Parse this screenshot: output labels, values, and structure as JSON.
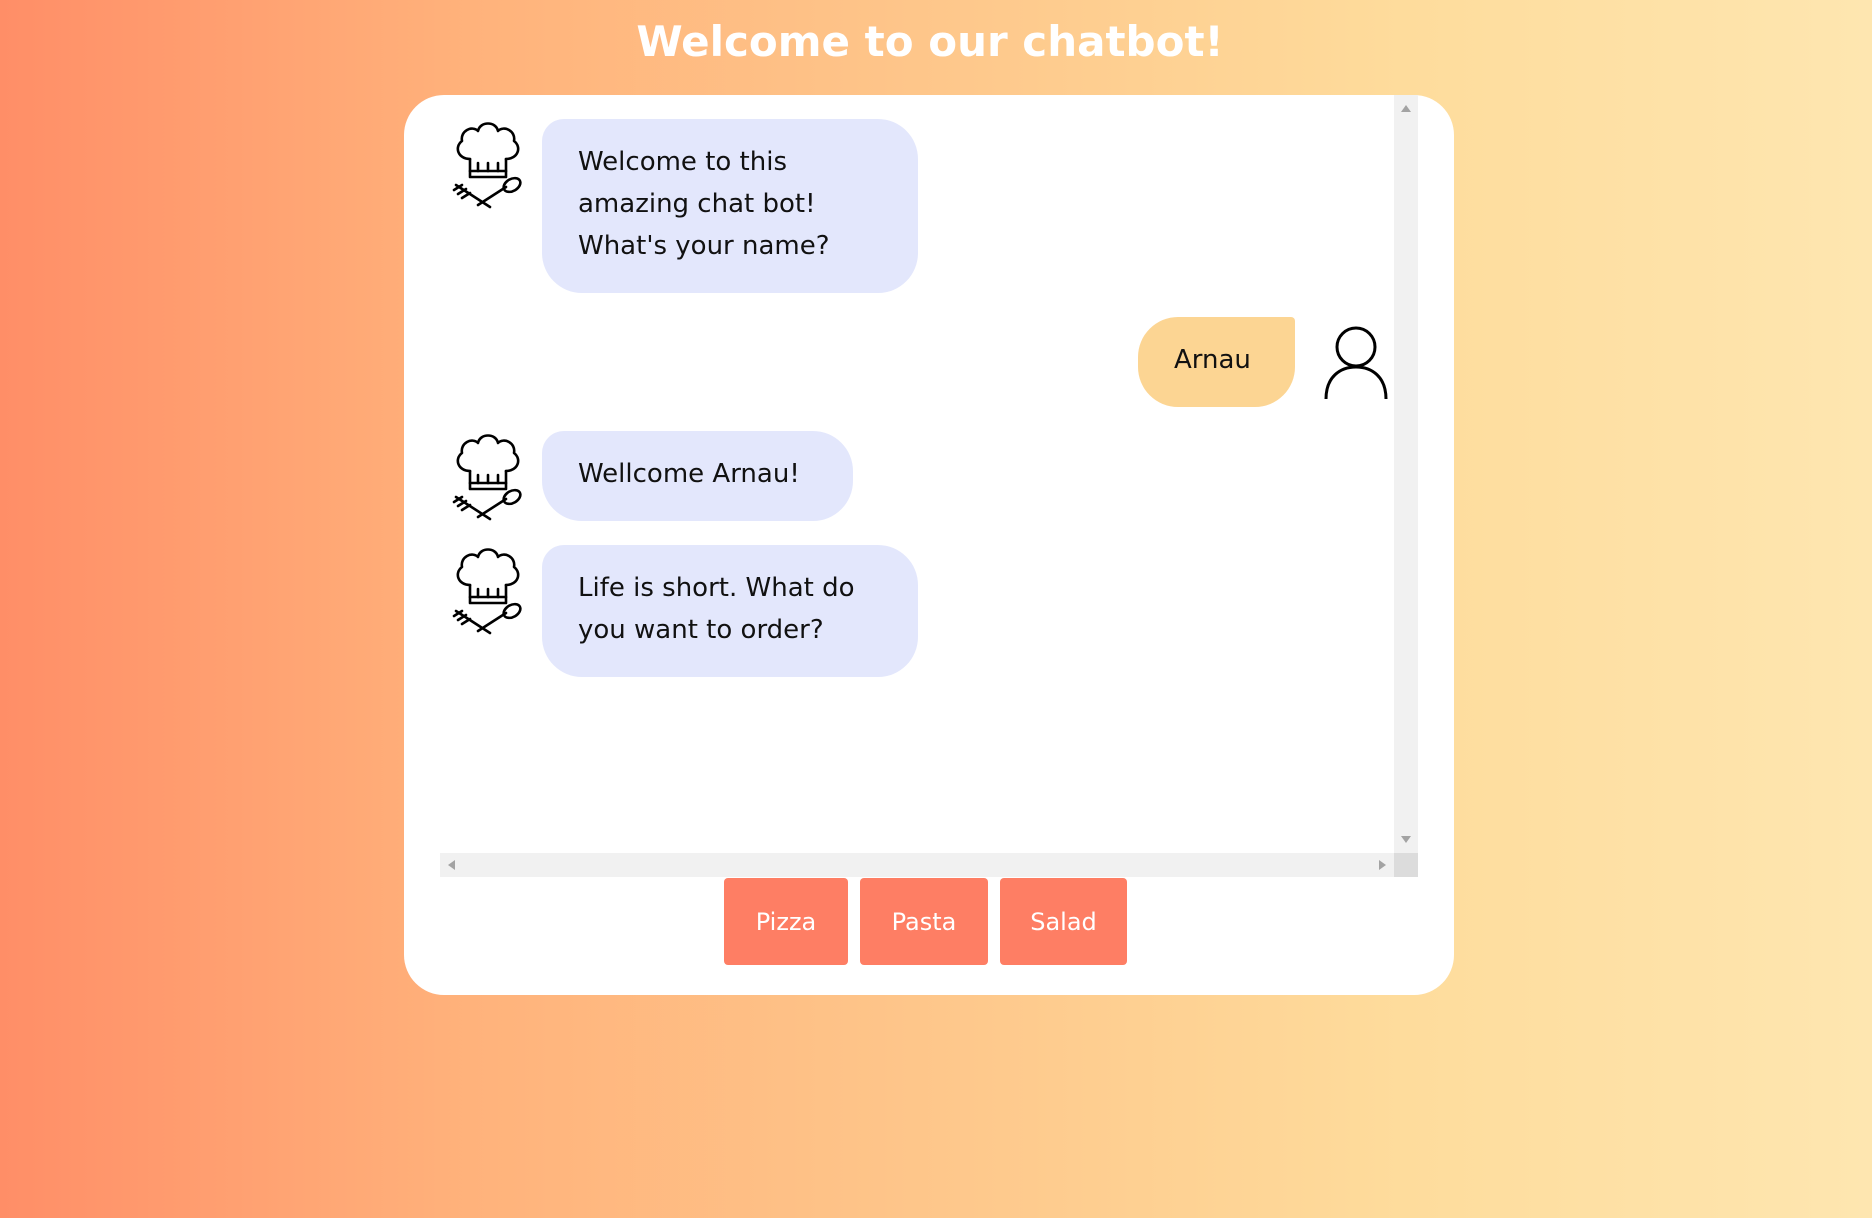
{
  "header": {
    "title": "Welcome to our chatbot!"
  },
  "chat": {
    "messages": [
      {
        "sender": "bot",
        "avatar_icon": "chef-hat-icon",
        "text": "Welcome to this amazing chat bot! What's your name?"
      },
      {
        "sender": "user",
        "avatar_icon": "user-icon",
        "text": "Arnau"
      },
      {
        "sender": "bot",
        "avatar_icon": "chef-hat-icon",
        "text": "Wellcome Arnau!"
      },
      {
        "sender": "bot",
        "avatar_icon": "chef-hat-icon",
        "text": "Life is short. What do you want to order?"
      }
    ]
  },
  "options": [
    {
      "label": "Pizza"
    },
    {
      "label": "Pasta"
    },
    {
      "label": "Salad"
    }
  ],
  "colors": {
    "bot_bubble": "#e3e7fc",
    "user_bubble": "#fcd593",
    "option_button": "#fe7e64",
    "card": "#ffffff"
  }
}
